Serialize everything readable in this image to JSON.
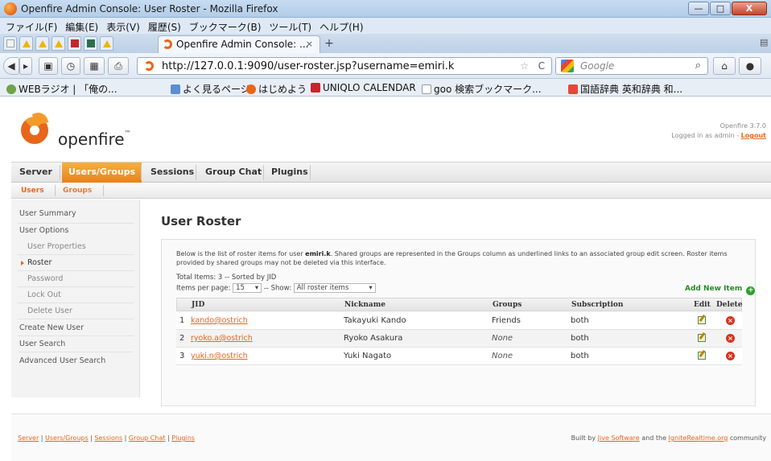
{
  "window": {
    "title": "Openfire Admin Console: User Roster - Mozilla Firefox",
    "min_label": "—",
    "max_label": "□",
    "close_label": "X"
  },
  "menu": [
    "ファイル(F)",
    "編集(E)",
    "表示(V)",
    "履歴(S)",
    "ブックマーク(B)",
    "ツール(T)",
    "ヘルプ(H)"
  ],
  "tabs": {
    "active_title": "Openfire Admin Console: ...",
    "close_glyph": "×",
    "new_tab_glyph": "+"
  },
  "nav": {
    "url": "http://127.0.0.1:9090/user-roster.jsp?username=emiri.k",
    "search_placeholder": "Google",
    "star_glyph": "☆",
    "reload_glyph": "C"
  },
  "bookmarks": [
    "WEBラジオ | 「俺の...",
    "よく見るページ",
    "はじめよう",
    "UNIQLO CALENDAR",
    "goo 検索ブックマーク...",
    "国語辞典 英和辞典 和..."
  ],
  "header": {
    "brand": "openfire",
    "version": "Openfire 3.7.0",
    "logged_in": "Logged in as admin -",
    "logout": "Logout"
  },
  "main_nav": [
    "Server",
    "Users/Groups",
    "Sessions",
    "Group Chat",
    "Plugins"
  ],
  "sub_nav": [
    "Users",
    "Groups"
  ],
  "sidebar": {
    "items": [
      {
        "label": "User Summary"
      },
      {
        "label": "User Options"
      },
      {
        "label": "User Properties"
      },
      {
        "label": "Roster"
      },
      {
        "label": "Password"
      },
      {
        "label": "Lock Out"
      },
      {
        "label": "Delete User"
      },
      {
        "label": "Create New User"
      },
      {
        "label": "User Search"
      },
      {
        "label": "Advanced User Search"
      }
    ]
  },
  "page": {
    "title": "User Roster",
    "desc_prefix": "Below is the list of roster items for user",
    "desc_user": "emiri.k",
    "desc_suffix": ". Shared groups are represented in the Groups column as underlined links to an associated group edit screen. Roster items provided by shared groups may not be deleted via this interface.",
    "total": "Total Items: 3 -- Sorted by JID",
    "per_page_label": "Items per page:",
    "per_page_value": "15",
    "show_label": "-- Show:",
    "show_value": "All roster items",
    "add_new": "Add New Item",
    "add_glyph": "+"
  },
  "table": {
    "headers": [
      "JID",
      "Nickname",
      "Groups",
      "Subscription",
      "Edit",
      "Delete"
    ],
    "rows": [
      {
        "n": "1",
        "jid": "kando@ostrich",
        "nick": "Takayuki Kando",
        "groups": "Friends",
        "sub": "both"
      },
      {
        "n": "2",
        "jid": "ryoko.a@ostrich",
        "nick": "Ryoko Asakura",
        "groups": "None",
        "sub": "both"
      },
      {
        "n": "3",
        "jid": "yuki.n@ostrich",
        "nick": "Yuki Nagato",
        "groups": "None",
        "sub": "both"
      }
    ]
  },
  "footer": {
    "links": [
      "Server",
      "Users/Groups",
      "Sessions",
      "Group Chat",
      "Plugins"
    ],
    "built_by": "Built by",
    "jive": "Jive Software",
    "and_the": "and the",
    "ignite": "IgniteRealtime.org",
    "community": "community"
  },
  "colors": {
    "accent": "#e8661a",
    "active_tab": "#f39a2a",
    "add_green": "#2a8a2a",
    "delete_red": "#d6341f"
  }
}
